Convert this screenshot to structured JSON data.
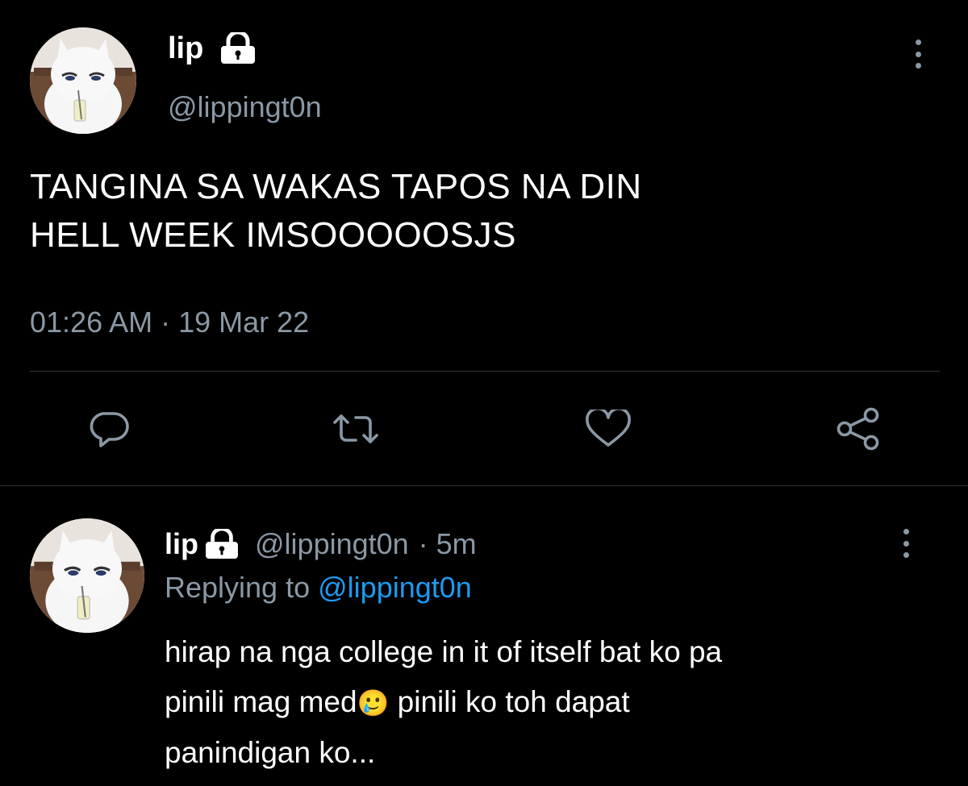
{
  "main_tweet": {
    "display_name": "lip",
    "handle": "@lippingt0n",
    "text_line1": "TANGINA SA WAKAS TAPOS NA DIN",
    "text_line2": "HELL WEEK IMSOOOOOSJS",
    "timestamp": "01:26 AM · 19 Mar 22",
    "icons": {
      "lock": "lock-icon",
      "more": "more-icon",
      "reply": "reply-icon",
      "retweet": "retweet-icon",
      "like": "heart-icon",
      "share": "share-icon"
    }
  },
  "reply_tweet": {
    "display_name": "lip",
    "handle": "@lippingt0n",
    "time_ago": "· 5m",
    "replying_to_label": "Replying to",
    "replying_to_handle": "@lippingt0n",
    "text_line1": "hirap na nga college in it of itself bat ko pa",
    "text_line2_a": "pinili mag med",
    "emoji": "🥲",
    "text_line2_b": " pinili ko toh dapat",
    "text_line3": "panindigan ko..."
  },
  "colors": {
    "background": "#000000",
    "muted": "#8b98a5",
    "accent": "#1d9bf0",
    "divider": "#2f3336"
  }
}
